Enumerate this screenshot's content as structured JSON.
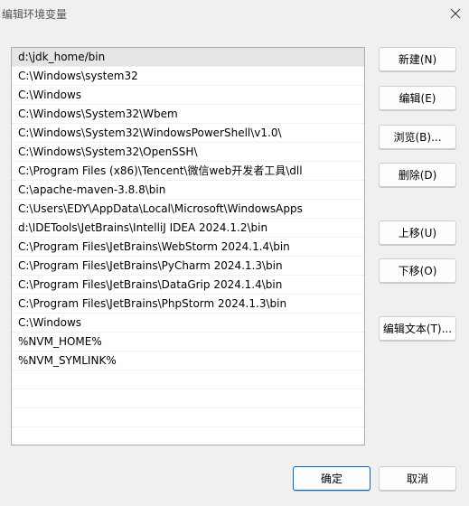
{
  "window": {
    "title": "编辑环境变量"
  },
  "paths": [
    "d:\\jdk_home/bin",
    "C:\\Windows\\system32",
    "C:\\Windows",
    "C:\\Windows\\System32\\Wbem",
    "C:\\Windows\\System32\\WindowsPowerShell\\v1.0\\",
    "C:\\Windows\\System32\\OpenSSH\\",
    "C:\\Program Files (x86)\\Tencent\\微信web开发者工具\\dll",
    "C:\\apache-maven-3.8.8\\bin",
    "C:\\Users\\EDY\\AppData\\Local\\Microsoft\\WindowsApps",
    "d:\\IDETools\\JetBrains\\IntelliJ IDEA 2024.1.2\\bin",
    "C:\\Program Files\\JetBrains\\WebStorm 2024.1.4\\bin",
    "C:\\Program Files\\JetBrains\\PyCharm 2024.1.3\\bin",
    "C:\\Program Files\\JetBrains\\DataGrip 2024.1.4\\bin",
    "C:\\Program Files\\JetBrains\\PhpStorm 2024.1.3\\bin",
    "C:\\Windows",
    "%NVM_HOME%",
    "%NVM_SYMLINK%"
  ],
  "empty_rows": 4,
  "buttons": {
    "new": "新建(N)",
    "edit": "编辑(E)",
    "browse": "浏览(B)...",
    "delete": "删除(D)",
    "up": "上移(U)",
    "down": "下移(O)",
    "edit_text": "编辑文本(T)...",
    "ok": "确定",
    "cancel": "取消"
  },
  "colors": {
    "selected_row": "#e5e5e5",
    "accent": "#0067c0"
  }
}
